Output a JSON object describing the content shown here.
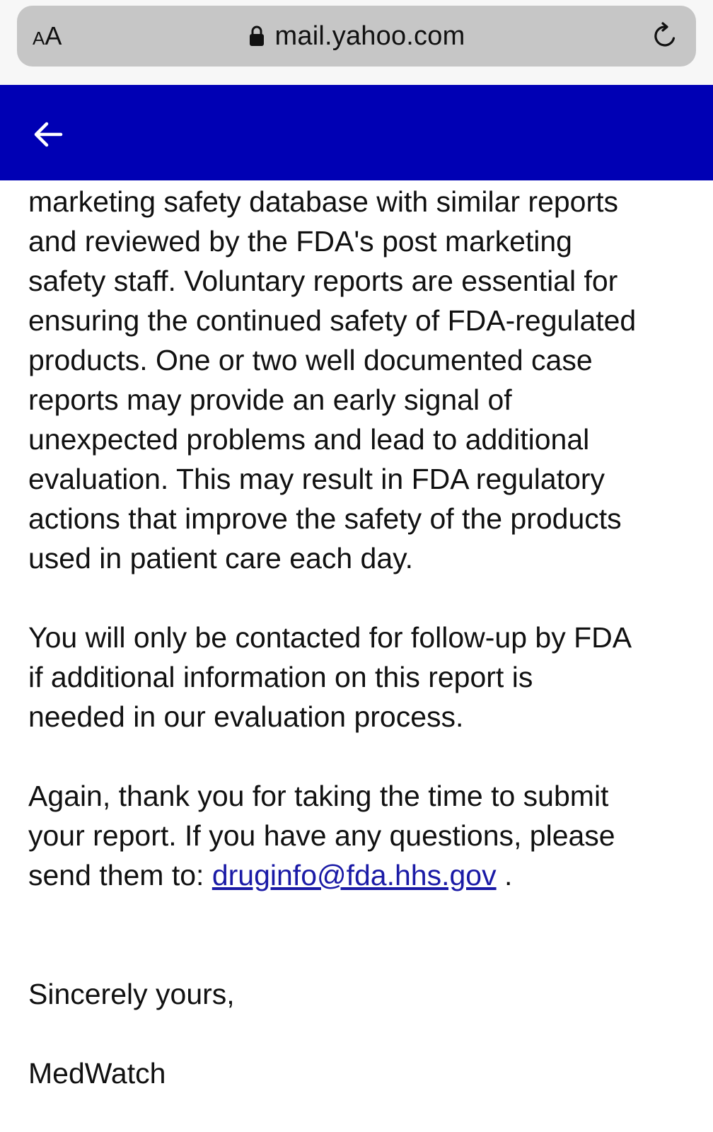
{
  "browser": {
    "text_size_small": "A",
    "text_size_big": "A",
    "url": "mail.yahoo.com"
  },
  "colors": {
    "header_bg": "#0000b4",
    "link": "#1a1aa6",
    "url_bar_bg": "#c6c6c6"
  },
  "header": {
    "back_icon": "arrow-left-icon"
  },
  "message": {
    "paragraph_1": "marketing safety database with similar reports\nand reviewed by the FDA's post marketing\nsafety staff.  Voluntary reports are essential for\nensuring the continued safety of FDA-regulated\nproducts.  One or two well documented case\nreports may provide an early signal of\nunexpected problems and lead to additional\nevaluation.  This may result in FDA regulatory\nactions that improve the safety of the products\nused in patient care each day.",
    "paragraph_2": "You will only be contacted for follow-up by FDA\nif additional information on this report is\nneeded in our evaluation process.",
    "paragraph_3_text": "Again, thank you for taking the time to submit\nyour report.  If you have any questions, please\nsend them to:  ",
    "paragraph_3_link": "druginfo@fda.hhs.gov",
    "paragraph_3_end": " .",
    "closing": "Sincerely yours,",
    "signature": "MedWatch"
  }
}
